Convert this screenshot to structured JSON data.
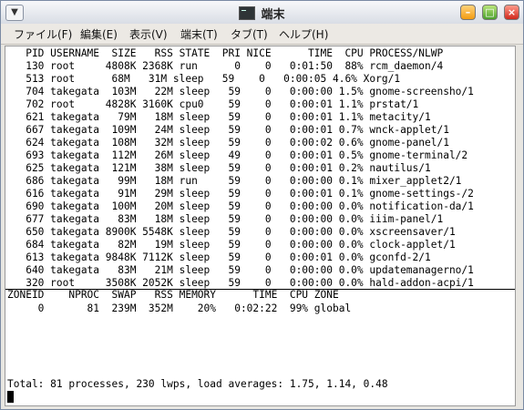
{
  "window": {
    "title": "端末"
  },
  "menu": [
    "ファイル(F)",
    "編集(E)",
    "表示(V)",
    "端末(T)",
    "タブ(T)",
    "ヘルプ(H)"
  ],
  "terminal": {
    "lines": [
      "   PID USERNAME  SIZE   RSS STATE  PRI NICE      TIME  CPU PROCESS/NLWP",
      "   130 root     4808K 2368K run      0    0   0:01:50  88% rcm_daemon/4",
      "   513 root      68M   31M sleep   59    0   0:00:05 4.6% Xorg/1",
      "   704 takegata  103M   22M sleep   59    0   0:00:00 1.5% gnome-screensho/1",
      "   702 root     4828K 3160K cpu0    59    0   0:00:01 1.1% prstat/1",
      "   621 takegata   79M   18M sleep   59    0   0:00:01 1.1% metacity/1",
      "   667 takegata  109M   24M sleep   59    0   0:00:01 0.7% wnck-applet/1",
      "   624 takegata  108M   32M sleep   59    0   0:00:02 0.6% gnome-panel/1",
      "   693 takegata  112M   26M sleep   49    0   0:00:01 0.5% gnome-terminal/2",
      "   625 takegata  121M   38M sleep   59    0   0:00:01 0.2% nautilus/1",
      "   686 takegata   99M   18M run     59    0   0:00:00 0.1% mixer_applet2/1",
      "   616 takegata   91M   29M sleep   59    0   0:00:01 0.1% gnome-settings-/2",
      "   690 takegata  100M   20M sleep   59    0   0:00:00 0.0% notification-da/1",
      "   677 takegata   83M   18M sleep   59    0   0:00:00 0.0% iiim-panel/1",
      "   650 takegata 8900K 5548K sleep   59    0   0:00:00 0.0% xscreensaver/1",
      "   684 takegata   82M   19M sleep   59    0   0:00:00 0.0% clock-applet/1",
      "   613 takegata 9848K 7112K sleep   59    0   0:00:01 0.0% gconfd-2/1",
      "   640 takegata   83M   21M sleep   59    0   0:00:00 0.0% updatemanagerno/1",
      "   320 root     3508K 2052K sleep   59    0   0:00:00 0.0% hald-addon-acpi/1",
      "ZONEID    NPROC  SWAP   RSS MEMORY      TIME  CPU ZONE",
      "     0       81  239M  352M    20%   0:02:22  99% global"
    ],
    "status_line": "Total: 81 processes, 230 lwps, load averages: 1.75, 1.14, 0.48"
  }
}
